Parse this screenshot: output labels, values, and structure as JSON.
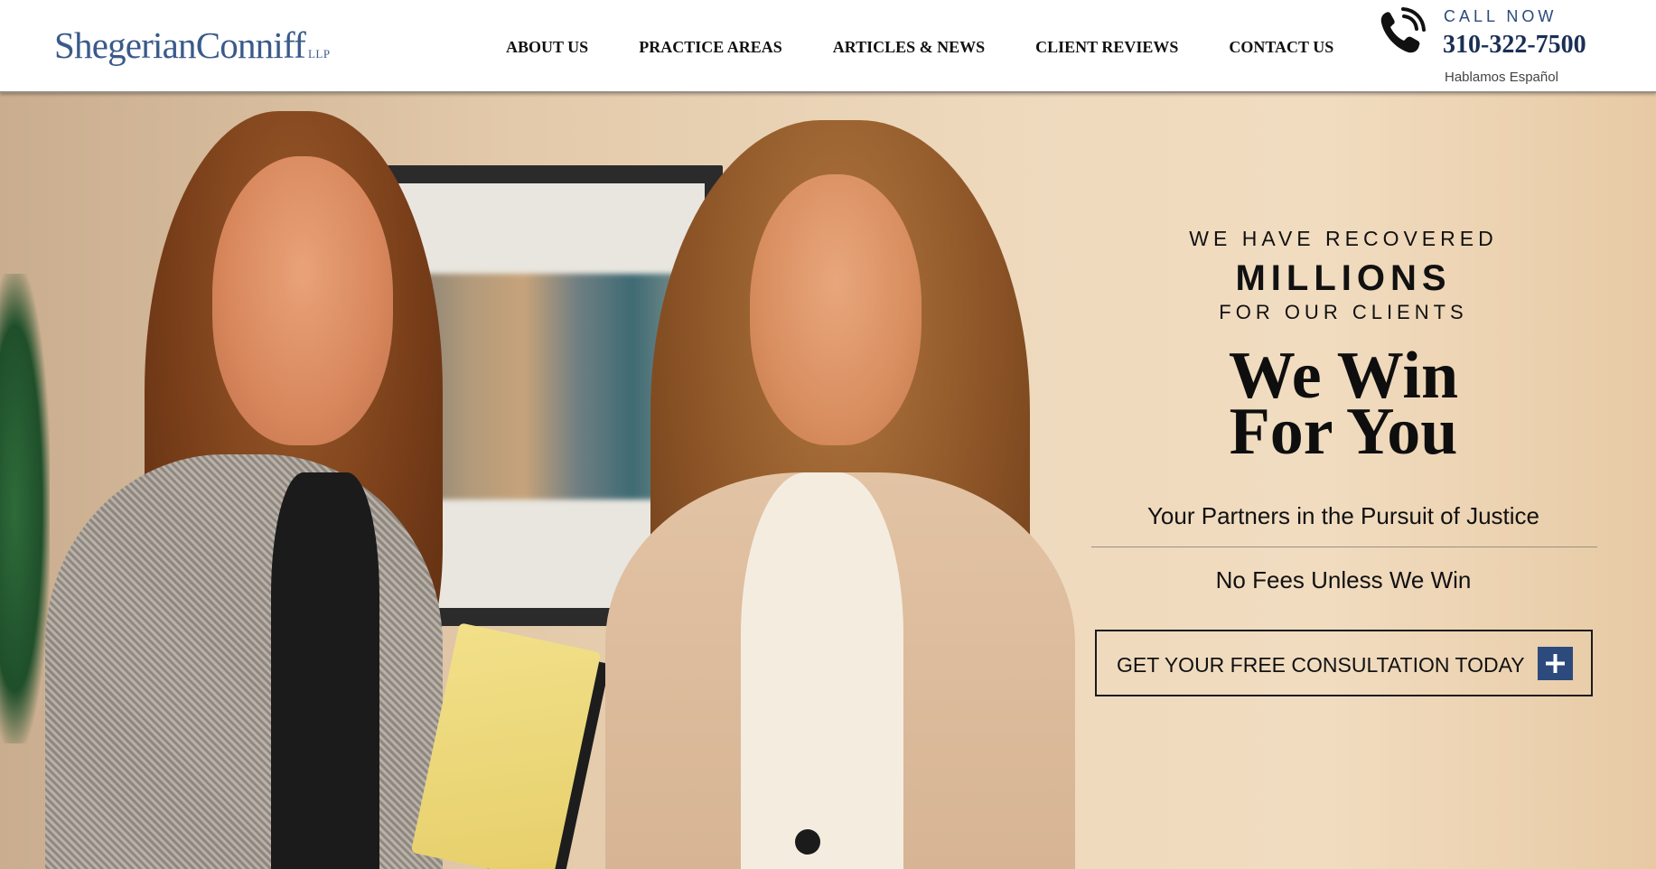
{
  "header": {
    "logo": {
      "name": "ShegerianConniff",
      "suffix": "LLP"
    },
    "nav": [
      {
        "label": "ABOUT US"
      },
      {
        "label": "PRACTICE AREAS"
      },
      {
        "label": "ARTICLES & NEWS"
      },
      {
        "label": "CLIENT REVIEWS"
      },
      {
        "label": "CONTACT US"
      }
    ],
    "call_now_label": "CALL NOW",
    "phone_number": "310-322-7500",
    "language_note": "Hablamos Español",
    "icons": {
      "phone": "phone-icon"
    },
    "colors": {
      "logo": "#3a5a8a",
      "call_now": "#2a4a7a",
      "phone": "#1a2f55"
    }
  },
  "hero": {
    "recovered_line1": "WE HAVE RECOVERED",
    "recovered_line2": "MILLIONS",
    "recovered_line3": "FOR OUR CLIENTS",
    "headline_line1": "We Win",
    "headline_line2": "For You",
    "tagline": "Your Partners in the Pursuit of Justice",
    "no_fees": "No Fees Unless We Win",
    "cta": {
      "label": "GET YOUR FREE CONSULTATION TODAY",
      "icon": "plus-icon",
      "icon_color": "#2c4a7c"
    }
  }
}
